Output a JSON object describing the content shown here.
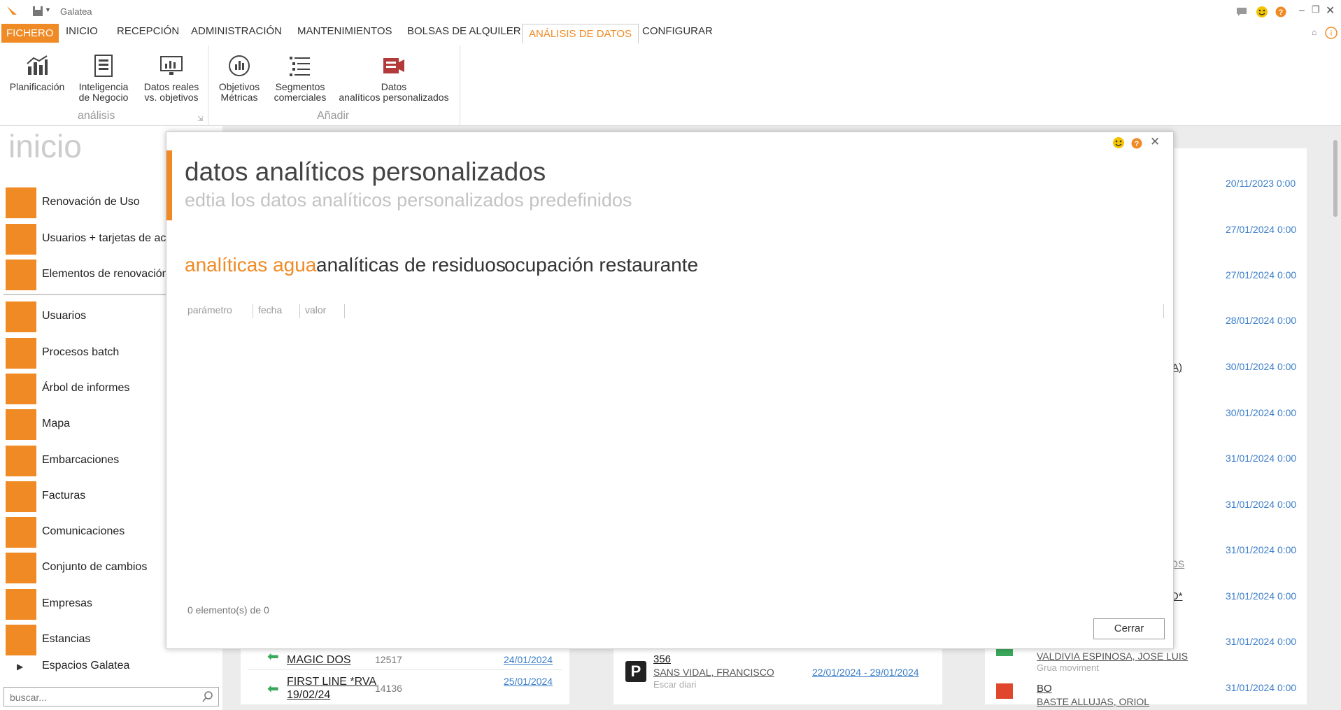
{
  "window": {
    "title": "Galatea"
  },
  "menu": {
    "file": "FICHERO",
    "items": [
      "INICIO",
      "RECEPCIÓN",
      "ADMINISTRACIÓN",
      "MANTENIMIENTOS",
      "BOLSAS DE ALQUILER",
      "ANÁLISIS DE DATOS",
      "CONFIGURAR"
    ],
    "active": "ANÁLISIS DE DATOS"
  },
  "ribbon": {
    "group1": {
      "label": "análisis",
      "buttons": [
        {
          "label1": "Planificación",
          "label2": ""
        },
        {
          "label1": "Inteligencia",
          "label2": "de Negocio"
        },
        {
          "label1": "Datos reales",
          "label2": "vs. objetivos"
        }
      ]
    },
    "group2": {
      "label": "Añadir",
      "buttons": [
        {
          "label1": "Objetivos",
          "label2": "Métricas"
        },
        {
          "label1": "Segmentos",
          "label2": "comerciales"
        },
        {
          "label1": "Datos",
          "label2": "analíticos personalizados"
        }
      ]
    }
  },
  "left": {
    "title": "inicio",
    "items": [
      "Renovación de Uso",
      "Usuarios + tarjetas de ac",
      "Elementos de renovación",
      "Usuarios",
      "Procesos batch",
      "Árbol de informes",
      "Mapa",
      "Embarcaciones",
      "Facturas",
      "Comunicaciones",
      "Conjunto de cambios",
      "Empresas",
      "Estancias"
    ],
    "footer_item": "Espacios Galatea",
    "search_placeholder": "buscar..."
  },
  "background": {
    "dates": [
      "20/11/2023 0:00",
      "27/01/2024 0:00",
      "27/01/2024 0:00",
      "28/01/2024 0:00",
      "30/01/2024 0:00",
      "30/01/2024 0:00",
      "31/01/2024 0:00",
      "31/01/2024 0:00",
      "31/01/2024 0:00",
      "31/01/2024 0:00",
      "31/01/2024 0:00",
      "31/01/2024 0:00"
    ],
    "fragments": [
      "A)",
      "OS",
      "O*"
    ],
    "boats": [
      {
        "name": "MAGIC DOS",
        "num": "12517",
        "date": "24/01/2024"
      },
      {
        "name": "FIRST LINE *RVA",
        "name2": "19/02/24",
        "num": "14136",
        "date": "25/01/2024"
      }
    ],
    "parking": {
      "num": "356",
      "owner": "SANS VIDAL, FRANCISCO",
      "range": "22/01/2024 - 29/01/2024",
      "note": "Escar diari"
    },
    "people": [
      {
        "name": "VALDIVIA ESPINOSA, JOSE LUIS",
        "note": "Grua moviment"
      },
      {
        "name": "BO",
        "name2": "BASTE ALLUJAS, ORIOL"
      }
    ]
  },
  "modal": {
    "title": "datos analíticos personalizados",
    "subtitle": "edtia los datos analíticos personalizados predefinidos",
    "tabs": [
      "analíticas agua",
      "analíticas de residuos",
      "ocupación restaurante"
    ],
    "columns": [
      "parámetro",
      "fecha",
      "valor"
    ],
    "count": "0 elemento(s) de 0",
    "close_label": "Cerrar"
  },
  "colors": {
    "accent": "#f08a24",
    "link": "#3a7dc9"
  }
}
